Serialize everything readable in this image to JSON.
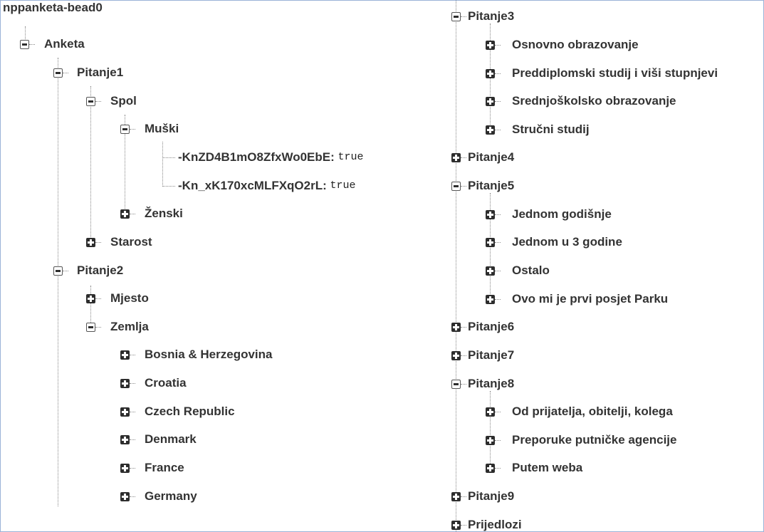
{
  "root_key": "nppanketa-bead0",
  "anketa": {
    "label": "Anketa",
    "pitanje1": {
      "label": "Pitanje1",
      "spol": {
        "label": "Spol",
        "muski": {
          "label": "Muški",
          "entries": [
            {
              "key": "-KnZD4B1mO8ZfxWo0EbE:",
              "value": "true"
            },
            {
              "key": "-Kn_xK170xcMLFXqO2rL:",
              "value": "true"
            }
          ]
        },
        "zenski": {
          "label": "Ženski"
        }
      },
      "starost": {
        "label": "Starost"
      }
    },
    "pitanje2": {
      "label": "Pitanje2",
      "mjesto": {
        "label": "Mjesto"
      },
      "zemlja": {
        "label": "Zemlja",
        "countries": [
          "Bosnia & Herzegovina",
          "Croatia",
          "Czech Republic",
          "Denmark",
          "France",
          "Germany"
        ]
      }
    },
    "pitanje3": {
      "label": "Pitanje3",
      "children": [
        "Osnovno obrazovanje",
        "Preddiplomski studij i viši stupnjevi",
        "Srednjoškolsko obrazovanje",
        "Stručni studij"
      ]
    },
    "pitanje4": {
      "label": "Pitanje4"
    },
    "pitanje5": {
      "label": "Pitanje5",
      "children": [
        "Jednom godišnje",
        "Jednom u 3 godine",
        "Ostalo",
        "Ovo mi je prvi posjet Parku"
      ]
    },
    "pitanje6": {
      "label": "Pitanje6"
    },
    "pitanje7": {
      "label": "Pitanje7"
    },
    "pitanje8": {
      "label": "Pitanje8",
      "children": [
        "Od prijatelja, obitelji, kolega",
        "Preporuke putničke agencije",
        "Putem weba"
      ]
    },
    "pitanje9": {
      "label": "Pitanje9"
    },
    "prijedlozi": {
      "label": "Prijedlozi"
    }
  }
}
